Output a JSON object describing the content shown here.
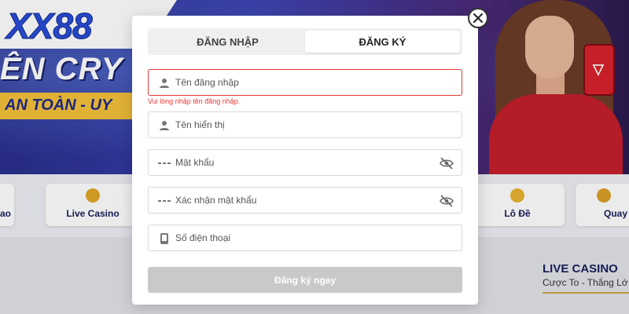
{
  "brand": {
    "logo": "XX88"
  },
  "banner": {
    "headline": "ÊN CRY",
    "subline": "AN TOÀN - UY"
  },
  "categories": [
    {
      "label": "ao",
      "icon": "dice-icon"
    },
    {
      "label": "Live Casino",
      "icon": "chips-icon"
    },
    {
      "label": "Lô Đề",
      "icon": "lottery-balls-icon"
    },
    {
      "label": "Quay",
      "icon": "slot-icon"
    }
  ],
  "promo": {
    "title": "LIVE CASINO",
    "subtitle": "Cược To - Thắng Lớ"
  },
  "modal": {
    "tabs": {
      "login": "ĐĂNG NHẬP",
      "register": "ĐĂNG KÝ",
      "active": "register"
    },
    "fields": {
      "username": {
        "placeholder": "Tên đăng nhập",
        "icon": "user-icon",
        "error": "Vui lòng nhập tên đăng nhập."
      },
      "display_name": {
        "placeholder": "Tên hiển thị",
        "icon": "user-icon"
      },
      "password": {
        "placeholder": "Mật khẩu",
        "icon": "password-dots-icon"
      },
      "confirm_password": {
        "placeholder": "Xác nhận mật khẩu",
        "icon": "password-dots-icon"
      },
      "phone": {
        "placeholder": "Số điện thoại",
        "icon": "phone-icon"
      }
    },
    "submit_label": "Đăng ký ngay"
  },
  "colors": {
    "error": "#e53935",
    "submit_disabled": "#c9c9c9",
    "brand_blue": "#2a4cd9",
    "accent_gold": "#f3c13a"
  }
}
